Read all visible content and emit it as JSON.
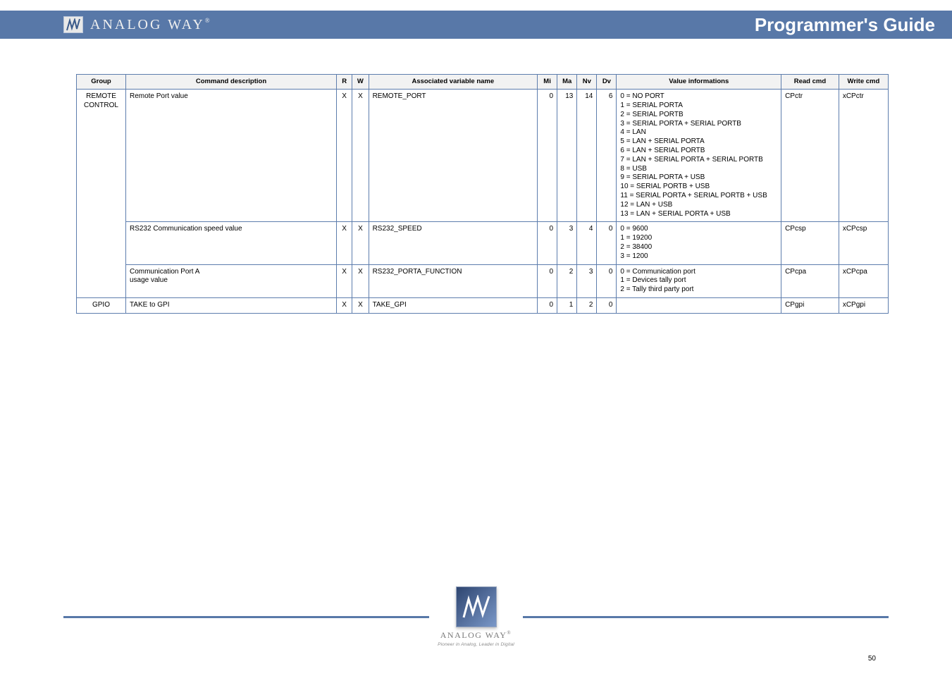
{
  "header": {
    "brand_text": "ANALOG WAY",
    "brand_reg": "®",
    "doc_title": "Programmer's Guide"
  },
  "table": {
    "headers": {
      "group": "Group",
      "cmd_desc": "Command description",
      "r": "R",
      "w": "W",
      "var_name": "Associated variable name",
      "mi": "Mi",
      "ma": "Ma",
      "nv": "Nv",
      "dv": "Dv",
      "value_info": "Value informations",
      "read_cmd": "Read cmd",
      "write_cmd": "Write cmd"
    },
    "rows": [
      {
        "group": "REMOTE CONTROL",
        "group_rowspan": 3,
        "desc": "Remote Port value",
        "r": "X",
        "w": "X",
        "var": "REMOTE_PORT",
        "mi": "0",
        "ma": "13",
        "nv": "14",
        "dv": "6",
        "info": "0 = NO PORT\n1 = SERIAL PORTA\n2 = SERIAL PORTB\n3 = SERIAL PORTA + SERIAL PORTB\n4 = LAN\n5 = LAN + SERIAL PORTA\n6 = LAN + SERIAL PORTB\n7 = LAN + SERIAL PORTA + SERIAL PORTB\n8 = USB\n9 = SERIAL PORTA + USB\n10 = SERIAL PORTB + USB\n11 = SERIAL PORTA + SERIAL PORTB + USB\n12 = LAN + USB\n13 = LAN + SERIAL PORTA + USB",
        "rcmd": "CPctr",
        "wcmd": "xCPctr"
      },
      {
        "desc": "RS232 Communication speed value",
        "r": "X",
        "w": "X",
        "var": "RS232_SPEED",
        "mi": "0",
        "ma": "3",
        "nv": "4",
        "dv": "0",
        "info": "0 = 9600\n1 = 19200\n2 = 38400\n3 = 1200",
        "rcmd": "CPcsp",
        "wcmd": "xCPcsp"
      },
      {
        "desc": "Communication Port A\nusage value",
        "r": "X",
        "w": "X",
        "var": "RS232_PORTA_FUNCTION",
        "mi": "0",
        "ma": "2",
        "nv": "3",
        "dv": "0",
        "info": "0 = Communication port\n1 = Devices tally port\n2 = Tally third party port",
        "rcmd": "CPcpa",
        "wcmd": "xCPcpa"
      },
      {
        "group": "GPIO",
        "group_rowspan": 1,
        "desc": "TAKE to GPI",
        "r": "X",
        "w": "X",
        "var": "TAKE_GPI",
        "mi": "0",
        "ma": "1",
        "nv": "2",
        "dv": "0",
        "info": "",
        "rcmd": "CPgpi",
        "wcmd": "xCPgpi"
      }
    ]
  },
  "footer": {
    "brand": "ANALOG WAY",
    "brand_reg": "®",
    "tagline": "Pioneer in Analog, Leader in Digital",
    "page": "50"
  }
}
